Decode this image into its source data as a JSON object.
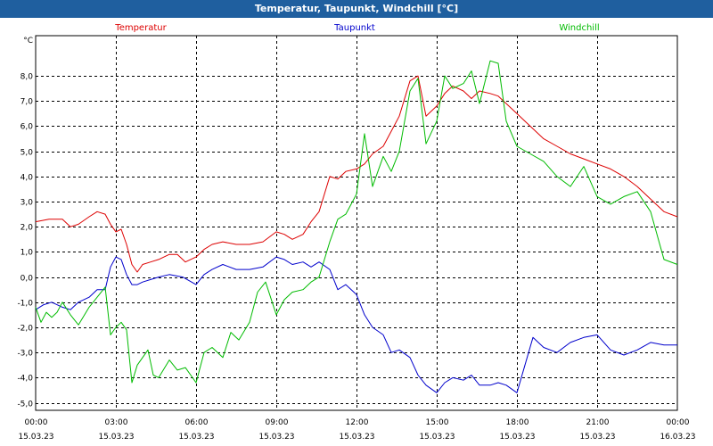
{
  "window": {
    "title": "Temperatur, Taupunkt, Windchill [°C]"
  },
  "chart_data": {
    "type": "line",
    "unit": "°C",
    "ylim": [
      -5.3,
      9.6
    ],
    "xlim_hours": [
      0,
      24
    ],
    "yticks": [
      {
        "value": 8,
        "label": "8,0"
      },
      {
        "value": 7,
        "label": "7,0"
      },
      {
        "value": 6,
        "label": "6,0"
      },
      {
        "value": 5,
        "label": "5,0"
      },
      {
        "value": 4,
        "label": "4,0"
      },
      {
        "value": 3,
        "label": "3,0"
      },
      {
        "value": 2,
        "label": "2,0"
      },
      {
        "value": 1,
        "label": "1,0"
      },
      {
        "value": 0,
        "label": "0,0"
      },
      {
        "value": -1,
        "label": "-1,0"
      },
      {
        "value": -2,
        "label": "-2,0"
      },
      {
        "value": -3,
        "label": "-3,0"
      },
      {
        "value": -4,
        "label": "-4,0"
      },
      {
        "value": -5,
        "label": "-5,0"
      }
    ],
    "xticks": [
      {
        "hour": 0,
        "time": "00:00",
        "date": "15.03.23"
      },
      {
        "hour": 3,
        "time": "03:00",
        "date": "15.03.23"
      },
      {
        "hour": 6,
        "time": "06:00",
        "date": "15.03.23"
      },
      {
        "hour": 9,
        "time": "09:00",
        "date": "15.03.23"
      },
      {
        "hour": 12,
        "time": "12:00",
        "date": "15.03.23"
      },
      {
        "hour": 15,
        "time": "15:00",
        "date": "15.03.23"
      },
      {
        "hour": 18,
        "time": "18:00",
        "date": "15.03.23"
      },
      {
        "hour": 21,
        "time": "21:00",
        "date": "15.03.23"
      },
      {
        "hour": 24,
        "time": "00:00",
        "date": "16.03.23"
      }
    ],
    "grid": true,
    "series": [
      {
        "name": "Temperatur",
        "color": "#dd0000",
        "x": [
          0,
          0.5,
          1,
          1.3,
          1.6,
          2,
          2.3,
          2.6,
          2.8,
          3,
          3.2,
          3.4,
          3.6,
          3.8,
          4,
          4.3,
          4.6,
          5,
          5.3,
          5.6,
          6,
          6.3,
          6.6,
          7,
          7.5,
          8,
          8.5,
          9,
          9.3,
          9.6,
          10,
          10.3,
          10.6,
          11,
          11.3,
          11.6,
          12,
          12.3,
          12.6,
          13,
          13.3,
          13.6,
          14,
          14.3,
          14.6,
          15,
          15.3,
          15.6,
          16,
          16.3,
          16.6,
          17,
          17.3,
          17.6,
          18,
          18.5,
          19,
          19.5,
          20,
          20.5,
          21,
          21.5,
          22,
          22.5,
          23,
          23.5,
          24
        ],
        "y": [
          2.2,
          2.3,
          2.3,
          2.0,
          2.1,
          2.4,
          2.6,
          2.5,
          2.1,
          1.8,
          1.9,
          1.3,
          0.5,
          0.2,
          0.5,
          0.6,
          0.7,
          0.9,
          0.9,
          0.6,
          0.8,
          1.1,
          1.3,
          1.4,
          1.3,
          1.3,
          1.4,
          1.8,
          1.7,
          1.5,
          1.7,
          2.2,
          2.6,
          4.0,
          3.9,
          4.2,
          4.3,
          4.5,
          4.9,
          5.2,
          5.8,
          6.4,
          7.8,
          8.0,
          6.4,
          6.8,
          7.3,
          7.6,
          7.4,
          7.1,
          7.4,
          7.3,
          7.2,
          6.9,
          6.5,
          6.0,
          5.5,
          5.2,
          4.9,
          4.7,
          4.5,
          4.3,
          4.0,
          3.6,
          3.1,
          2.6,
          2.4
        ]
      },
      {
        "name": "Taupunkt",
        "color": "#0000cc",
        "x": [
          0,
          0.3,
          0.6,
          1,
          1.3,
          1.6,
          2,
          2.3,
          2.6,
          2.8,
          3,
          3.2,
          3.4,
          3.6,
          3.8,
          4,
          4.3,
          4.6,
          5,
          5.5,
          6,
          6.3,
          6.6,
          7,
          7.5,
          8,
          8.5,
          9,
          9.3,
          9.6,
          10,
          10.3,
          10.6,
          11,
          11.3,
          11.6,
          12,
          12.3,
          12.6,
          13,
          13.3,
          13.6,
          14,
          14.3,
          14.6,
          15,
          15.3,
          15.6,
          16,
          16.3,
          16.6,
          17,
          17.3,
          17.6,
          18,
          18.3,
          18.6,
          19,
          19.5,
          20,
          20.5,
          21,
          21.5,
          22,
          22.5,
          23,
          23.5,
          24
        ],
        "y": [
          -1.3,
          -1.1,
          -1.0,
          -1.2,
          -1.3,
          -1.0,
          -0.8,
          -0.5,
          -0.5,
          0.4,
          0.8,
          0.7,
          0.1,
          -0.3,
          -0.3,
          -0.2,
          -0.1,
          0.0,
          0.1,
          0.0,
          -0.3,
          0.1,
          0.3,
          0.5,
          0.3,
          0.3,
          0.4,
          0.8,
          0.7,
          0.5,
          0.6,
          0.4,
          0.6,
          0.3,
          -0.5,
          -0.3,
          -0.7,
          -1.5,
          -2.0,
          -2.3,
          -3.0,
          -2.9,
          -3.2,
          -3.9,
          -4.3,
          -4.6,
          -4.2,
          -4.0,
          -4.1,
          -3.9,
          -4.3,
          -4.3,
          -4.2,
          -4.3,
          -4.6,
          -3.5,
          -2.4,
          -2.8,
          -3.0,
          -2.6,
          -2.4,
          -2.3,
          -2.9,
          -3.1,
          -2.9,
          -2.6,
          -2.7,
          -2.7
        ]
      },
      {
        "name": "Windchill",
        "color": "#00bb00",
        "x": [
          0,
          0.2,
          0.4,
          0.6,
          0.8,
          1,
          1.3,
          1.6,
          2,
          2.3,
          2.6,
          2.8,
          3,
          3.2,
          3.4,
          3.6,
          3.8,
          4,
          4.2,
          4.4,
          4.6,
          5,
          5.3,
          5.6,
          6,
          6.3,
          6.6,
          7,
          7.3,
          7.6,
          8,
          8.3,
          8.6,
          9,
          9.3,
          9.6,
          10,
          10.3,
          10.6,
          11,
          11.3,
          11.6,
          12,
          12.3,
          12.6,
          13,
          13.3,
          13.6,
          14,
          14.3,
          14.6,
          15,
          15.3,
          15.6,
          16,
          16.3,
          16.6,
          17,
          17.3,
          17.6,
          18,
          18.5,
          19,
          19.5,
          20,
          20.5,
          21,
          21.5,
          22,
          22.5,
          23,
          23.5,
          24
        ],
        "y": [
          -1.2,
          -1.8,
          -1.4,
          -1.6,
          -1.4,
          -1.0,
          -1.5,
          -1.9,
          -1.2,
          -0.8,
          -0.4,
          -2.3,
          -2.0,
          -1.8,
          -2.1,
          -4.2,
          -3.5,
          -3.2,
          -2.9,
          -3.9,
          -4.0,
          -3.3,
          -3.7,
          -3.6,
          -4.2,
          -3.0,
          -2.8,
          -3.2,
          -2.2,
          -2.5,
          -1.8,
          -0.6,
          -0.2,
          -1.5,
          -0.9,
          -0.6,
          -0.5,
          -0.2,
          0.0,
          1.4,
          2.3,
          2.5,
          3.3,
          5.7,
          3.6,
          4.8,
          4.2,
          5.0,
          7.4,
          7.9,
          5.3,
          6.2,
          8.0,
          7.5,
          7.7,
          8.2,
          6.9,
          8.6,
          8.5,
          6.2,
          5.2,
          4.9,
          4.6,
          4.0,
          3.6,
          4.4,
          3.2,
          2.9,
          3.2,
          3.4,
          2.6,
          0.7,
          0.5
        ]
      }
    ]
  }
}
